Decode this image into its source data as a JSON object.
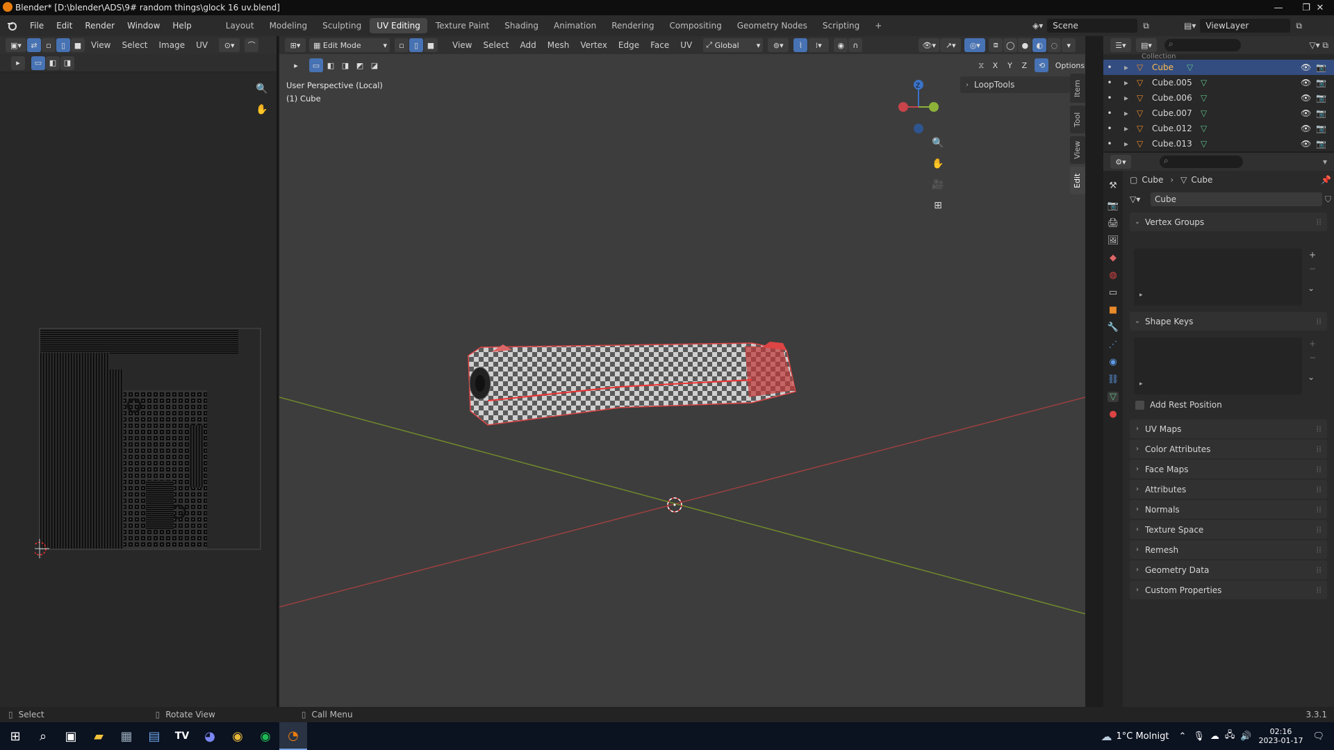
{
  "window": {
    "title": "Blender* [D:\\blender\\ADS\\9# random things\\glock 16 uv.blend]"
  },
  "menu": {
    "file": "File",
    "edit": "Edit",
    "render": "Render",
    "window": "Window",
    "help": "Help"
  },
  "workspaces": [
    "Layout",
    "Modeling",
    "Sculpting",
    "UV Editing",
    "Texture Paint",
    "Shading",
    "Animation",
    "Rendering",
    "Compositing",
    "Geometry Nodes",
    "Scripting"
  ],
  "active_workspace": "UV Editing",
  "scene": {
    "label": "Scene",
    "view_layer": "ViewLayer"
  },
  "uv_editor": {
    "view": "View",
    "select": "Select",
    "image": "Image",
    "uv": "UV"
  },
  "viewport": {
    "mode": "Edit Mode",
    "view": "View",
    "select": "Select",
    "add": "Add",
    "mesh": "Mesh",
    "vertex": "Vertex",
    "edge": "Edge",
    "face": "Face",
    "uv": "UV",
    "orientation": "Global",
    "overlay_line1": "User Perspective (Local)",
    "overlay_line2": "(1) Cube",
    "options": "Options",
    "axes": {
      "x": "X",
      "y": "Y",
      "z": "Z"
    },
    "loop_tools": "LoopTools",
    "side_tabs": [
      "Item",
      "Tool",
      "View",
      "Edit"
    ]
  },
  "outliner": {
    "top_label": "Collection",
    "items": [
      {
        "name": "Cube",
        "selected": true
      },
      {
        "name": "Cube.005",
        "selected": false
      },
      {
        "name": "Cube.006",
        "selected": false
      },
      {
        "name": "Cube.007",
        "selected": false
      },
      {
        "name": "Cube.012",
        "selected": false
      },
      {
        "name": "Cube.013",
        "selected": false
      }
    ]
  },
  "properties": {
    "breadcrumb_object": "Cube",
    "breadcrumb_data": "Cube",
    "data_name": "Cube",
    "vertex_groups": "Vertex Groups",
    "shape_keys": "Shape Keys",
    "add_rest_position": "Add Rest Position",
    "sections": [
      "UV Maps",
      "Color Attributes",
      "Face Maps",
      "Attributes",
      "Normals",
      "Texture Space",
      "Remesh",
      "Geometry Data",
      "Custom Properties"
    ]
  },
  "status": {
    "select": "Select",
    "rotate": "Rotate View",
    "call_menu": "Call Menu",
    "version": "3.3.1"
  },
  "taskbar": {
    "weather": "1°C Molnigt",
    "time": "02:16",
    "date": "2023-01-17"
  },
  "colors": {
    "accent": "#4772b3",
    "selected_row": "#334d80",
    "axis_red": "#c8444a",
    "axis_green": "#8cb23a",
    "axis_blue": "#3a73c8"
  }
}
